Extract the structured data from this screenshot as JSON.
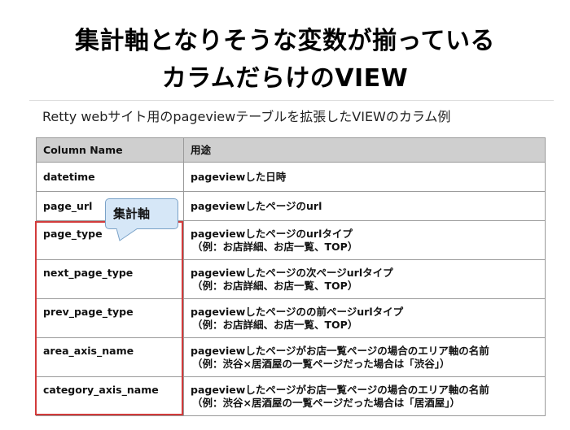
{
  "slide": {
    "title_line1": "集計軸となりそうな変数が揃っている",
    "title_line2": "カラムだらけのVIEW",
    "subtitle": "Retty webサイト用のpageviewテーブルを拡張したVIEWのカラム例"
  },
  "table": {
    "headers": [
      "Column Name",
      "用途"
    ],
    "rows": [
      {
        "name": "datetime",
        "usage": "pageviewした日時",
        "example": ""
      },
      {
        "name": "page_url",
        "usage": "pageviewしたページのurl",
        "example": ""
      },
      {
        "name": "page_type",
        "usage": "pageviewしたページのurlタイプ",
        "example": "（例：お店詳細、お店一覧、TOP）"
      },
      {
        "name": "next_page_type",
        "usage": "pageviewしたページの次ページurlタイプ",
        "example": "（例：お店詳細、お店一覧、TOP）"
      },
      {
        "name": "prev_page_type",
        "usage": "pageviewしたページのの前ページurlタイプ",
        "example": "（例：お店詳細、お店一覧、TOP）"
      },
      {
        "name": "area_axis_name",
        "usage": "pageviewしたページがお店一覧ページの場合のエリア軸の名前",
        "example": "（例：渋谷×居酒屋の一覧ページだった場合は「渋谷」）"
      },
      {
        "name": "category_axis_name",
        "usage": "pageviewしたページがお店一覧ページの場合のエリア軸の名前",
        "example": "（例：渋谷×居酒屋の一覧ページだった場合は「居酒屋」）"
      }
    ]
  },
  "callout": {
    "label": "集計軸"
  },
  "colors": {
    "highlight": "#d23b3b",
    "callout_fill": "#d6e7f7",
    "header_fill": "#cfcfcf"
  }
}
